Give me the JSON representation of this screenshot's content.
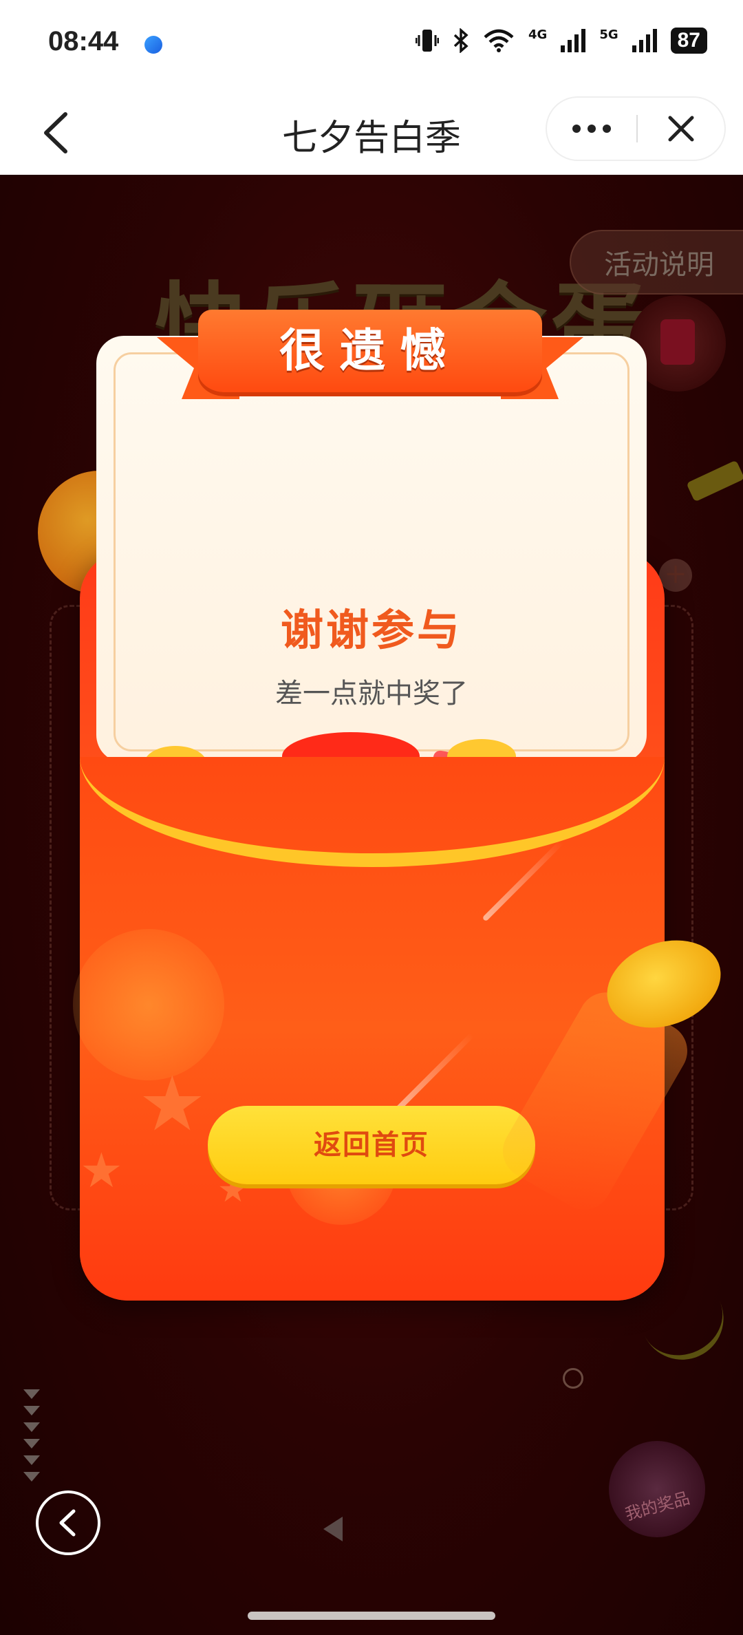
{
  "status_bar": {
    "time": "08:44",
    "signal_4g": "4G",
    "signal_5g": "5G",
    "battery": "87"
  },
  "nav": {
    "title": "七夕告白季"
  },
  "background": {
    "title": "快乐砸金蛋",
    "rules_label": "活动说明",
    "my_prize_label": "我的奖品"
  },
  "modal": {
    "banner": "很遗憾",
    "title": "谢谢参与",
    "subtitle": "差一点就中奖了",
    "home_button": "返回首页"
  },
  "colors": {
    "banner": "#ff5a18",
    "envelope": "#ff4a14",
    "button": "#ffd21e",
    "button_text": "#e04a10",
    "title_text": "#f05a1e"
  },
  "icons": [
    "back-icon",
    "more-icon",
    "close-icon",
    "bluetooth-icon",
    "wifi-icon",
    "plus-icon",
    "arrow-left-icon"
  ]
}
